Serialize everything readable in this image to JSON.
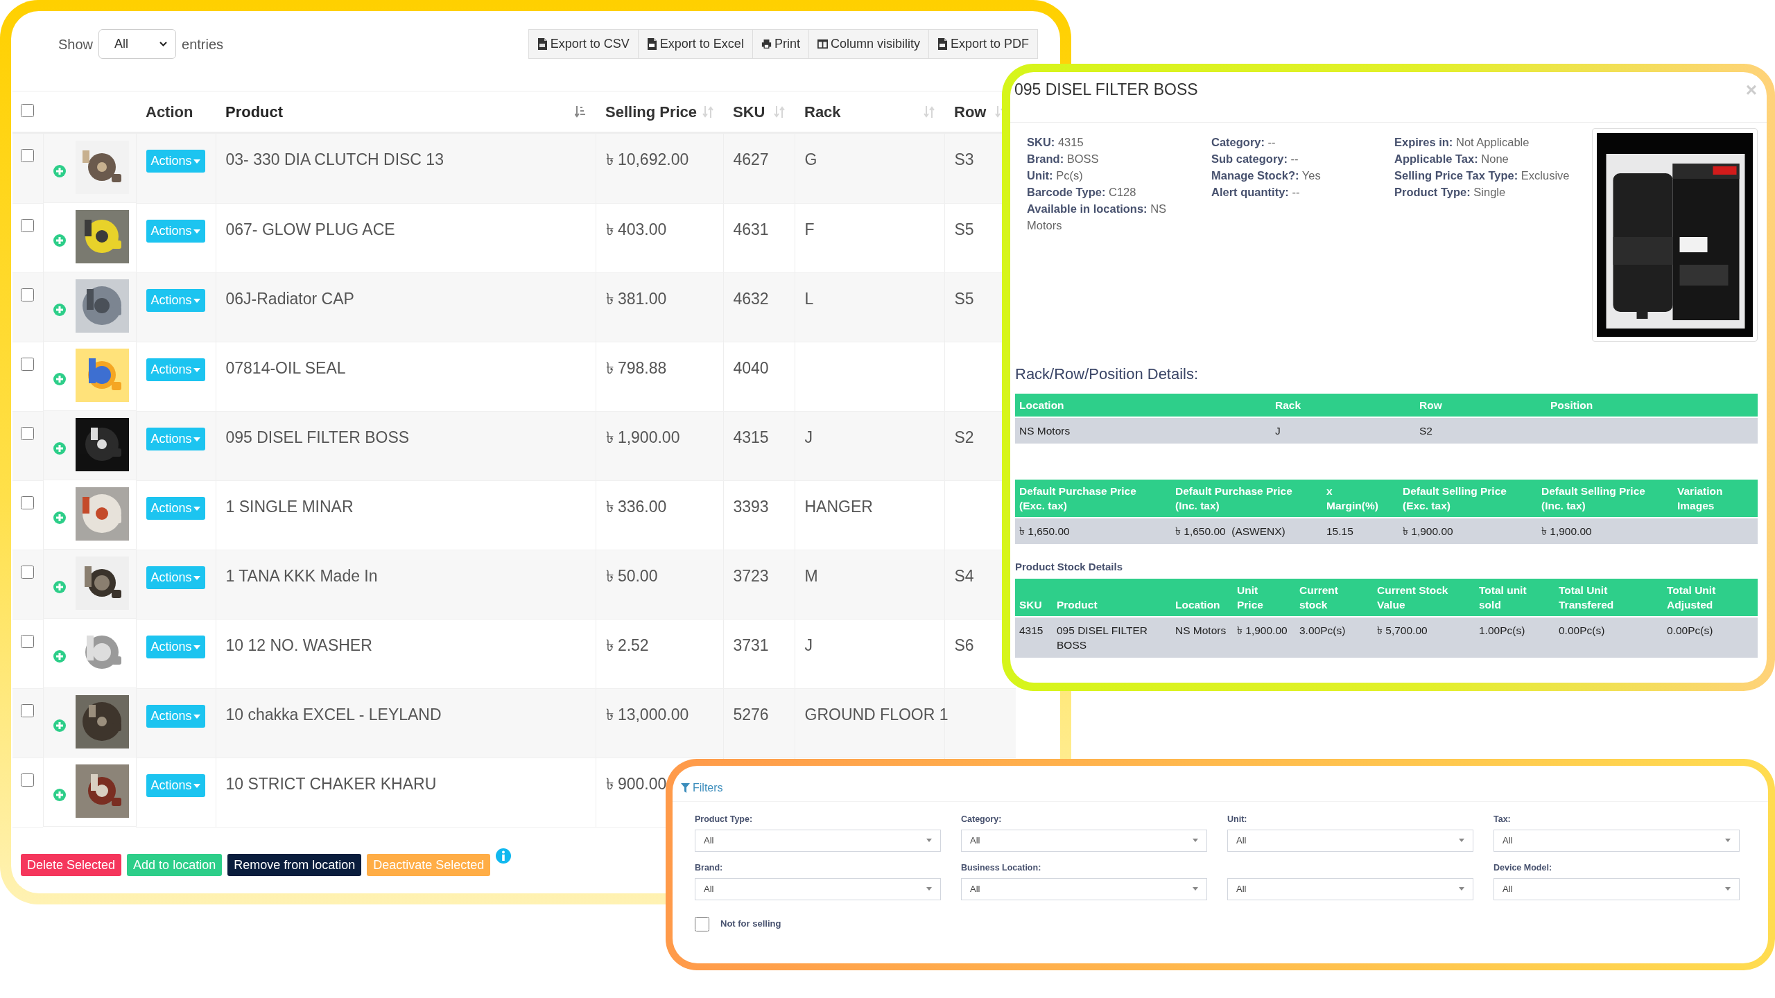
{
  "toolbar": {
    "show_label": "Show",
    "page_length": "All",
    "entries_label": "entries",
    "buttons": [
      "Export to CSV",
      "Export to Excel",
      "Print",
      "Column visibility",
      "Export to PDF"
    ]
  },
  "table": {
    "select_all": {
      "checked": false
    },
    "columns": [
      {
        "label": "Action"
      },
      {
        "label": "Product",
        "sortable": true,
        "sorted": true
      },
      {
        "label": "Selling Price",
        "sortable": true,
        "sorted": false
      },
      {
        "label": "SKU",
        "sortable": true,
        "sorted": false
      },
      {
        "label": "Rack",
        "sortable": true,
        "sorted": false
      },
      {
        "label": "Row",
        "sortable": true,
        "sorted": false
      }
    ],
    "rows": [
      {
        "checked": false,
        "thumb": {
          "kind": "picture"
        },
        "action": "Actions",
        "product": "03- 330 DIA CLUTCH DISC 13",
        "price": "৳ 10,692.00",
        "sku": "4627",
        "rack": "G",
        "row": "S3"
      },
      {
        "checked": false,
        "thumb": {
          "kind": "picture"
        },
        "action": "Actions",
        "product": "067- GLOW PLUG ACE",
        "price": "৳ 403.00",
        "sku": "4631",
        "rack": "F",
        "row": "S5"
      },
      {
        "checked": false,
        "thumb": {
          "kind": "picture"
        },
        "action": "Actions",
        "product": "06J-Radiator CAP",
        "price": "৳ 381.00",
        "sku": "4632",
        "rack": "L",
        "row": "S5"
      },
      {
        "checked": false,
        "thumb": {
          "kind": "picture"
        },
        "action": "Actions",
        "product": "07814-OIL SEAL",
        "price": "৳ 798.88",
        "sku": "4040"
      },
      {
        "checked": false,
        "thumb": {
          "kind": "picture"
        },
        "action": "Actions",
        "product": "095 DISEL FILTER BOSS",
        "price": "৳ 1,900.00",
        "sku": "4315",
        "rack": "J",
        "row": "S2"
      },
      {
        "checked": false,
        "thumb": {
          "kind": "picture"
        },
        "action": "Actions",
        "product": "1 SINGLE MINAR",
        "price": "৳ 336.00",
        "sku": "3393",
        "rack": "HANGER"
      },
      {
        "checked": false,
        "thumb": {
          "kind": "picture"
        },
        "action": "Actions",
        "product": "1 TANA KKK Made In",
        "price": "৳ 50.00",
        "sku": "3723",
        "rack": "M",
        "row": "S4"
      },
      {
        "checked": false,
        "thumb": {
          "kind": "picture"
        },
        "action": "Actions",
        "product": "10 12 NO. WASHER",
        "price": "৳ 2.52",
        "sku": "3731",
        "rack": "J",
        "row": "S6"
      },
      {
        "checked": false,
        "thumb": {
          "kind": "picture"
        },
        "action": "Actions",
        "product": "10 chakka EXCEL - LEYLAND",
        "price": "৳ 13,000.00",
        "sku": "5276",
        "rack": "GROUND FLOOR 1"
      },
      {
        "checked": false,
        "thumb": {
          "kind": "picture"
        },
        "action": "Actions",
        "product": "10 STRICT CHAKER KHARU",
        "price": "৳ 900.00"
      }
    ]
  },
  "bulk_actions": [
    {
      "label": "Delete Selected",
      "color": "#f5365c"
    },
    {
      "label": "Add to location",
      "color": "#2dce89"
    },
    {
      "label": "Remove from location",
      "color": "#0a1d3d"
    },
    {
      "label": "Deactivate Selected",
      "color": "#ffad46"
    }
  ],
  "modal": {
    "title": "095 DISEL FILTER BOSS",
    "close": "×",
    "info_columns": [
      [
        "**SKU:** 4315",
        "**Brand:** BOSS",
        "**Unit:** Pc(s)",
        "**Barcode Type:** C128",
        "**Available in locations:** NS Motors"
      ],
      [
        "**Category:** --",
        "**Sub category:** --",
        "**Manage Stock?:** Yes",
        "**Alert quantity:** --"
      ],
      [
        "**Expires in:** Not Applicable",
        "**Applicable Tax:** None",
        "**Selling Price Tax Type:** Exclusive",
        "**Product Type:** Single"
      ]
    ],
    "image": {
      "kind": "picture"
    },
    "rack_heading": "Rack/Row/Position Details:",
    "rack_table": {
      "columns": [
        "Location",
        "Rack",
        "Row",
        "Position"
      ],
      "rows": [
        [
          "NS Motors",
          "J",
          "S2"
        ]
      ]
    },
    "price_table": {
      "columns": [
        "Default Purchase Price (Exc. tax)",
        "Default Purchase Price (Inc. tax)",
        "x Margin(%)",
        "Default Selling Price (Exc. tax)",
        "Default Selling Price (Inc. tax)",
        "Variation Images"
      ],
      "rows": [
        [
          "৳ 1,650.00",
          "৳ 1,650.00  (ASWENX)",
          "15.15",
          "৳ 1,900.00",
          "৳ 1,900.00"
        ]
      ]
    },
    "stock_heading": "Product Stock Details",
    "stock_table": {
      "columns": [
        "SKU",
        "Product",
        "Location",
        "Unit Price",
        "Current stock",
        "Current Stock Value",
        "Total unit sold",
        "Total Unit Transfered",
        "Total Unit Adjusted"
      ],
      "rows": [
        [
          "4315",
          "095 DISEL FILTER BOSS",
          "NS Motors",
          "৳ 1,900.00",
          "3.00Pc(s)",
          "৳ 5,700.00",
          "1.00Pc(s)",
          "0.00Pc(s)",
          "0.00Pc(s)"
        ]
      ]
    }
  },
  "filters": {
    "title": "Filters",
    "fields": [
      {
        "label": "Product Type:",
        "value": "All"
      },
      {
        "label": "Category:",
        "value": "All"
      },
      {
        "label": "Unit:",
        "value": "All"
      },
      {
        "label": "Tax:",
        "value": "All"
      },
      {
        "label": "Brand:",
        "value": "All"
      },
      {
        "label": "Business Location:",
        "value": "All"
      },
      {
        "value": "All"
      },
      {
        "label": "Device Model:",
        "value": "All"
      }
    ],
    "checkboxes": [
      {
        "label": "Not for selling",
        "checked": false
      }
    ]
  }
}
